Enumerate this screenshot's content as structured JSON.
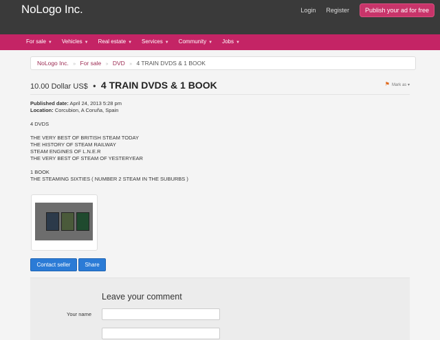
{
  "header": {
    "logo": "NoLogo Inc.",
    "login": "Login",
    "register": "Register",
    "publish": "Publish your ad for free"
  },
  "nav": [
    {
      "label": "For sale"
    },
    {
      "label": "Vehicles"
    },
    {
      "label": "Real estate"
    },
    {
      "label": "Services"
    },
    {
      "label": "Community"
    },
    {
      "label": "Jobs"
    }
  ],
  "breadcrumb": {
    "home": "NoLogo Inc.",
    "category": "For sale",
    "subcategory": "DVD",
    "current": "4 TRAIN DVDS & 1 BOOK",
    "separator": "»"
  },
  "ad": {
    "price": "10.00 Dollar US$",
    "dot": "•",
    "title": "4 TRAIN DVDS & 1 BOOK",
    "mark_as": "Mark as",
    "published_label": "Published date:",
    "published_value": "April 24, 2013 5:28 pm",
    "location_label": "Location:",
    "location_value": "Corcubion, A Coruña, Spain",
    "description": [
      "4 DVDS",
      "",
      "THE VERY BEST OF BRITISH STEAM TODAY",
      "THE HISTORY OF STEAM RAILWAY",
      "STEAM ENGINES OF L.N.E.R",
      "THE VERY BEST OF STEAM OF YESTERYEAR",
      "",
      "1 BOOK",
      "THE STEAMING SIXTIES ( NUMBER 2 STEAM IN THE SUBURBS )"
    ]
  },
  "buttons": {
    "contact": "Contact seller",
    "share": "Share"
  },
  "comment": {
    "heading": "Leave your comment",
    "name_label": "Your name"
  },
  "colors": {
    "topbar": "#3a3a3a",
    "nav": "#c42465",
    "accent": "#c8346a",
    "button": "#2b7bd6"
  }
}
